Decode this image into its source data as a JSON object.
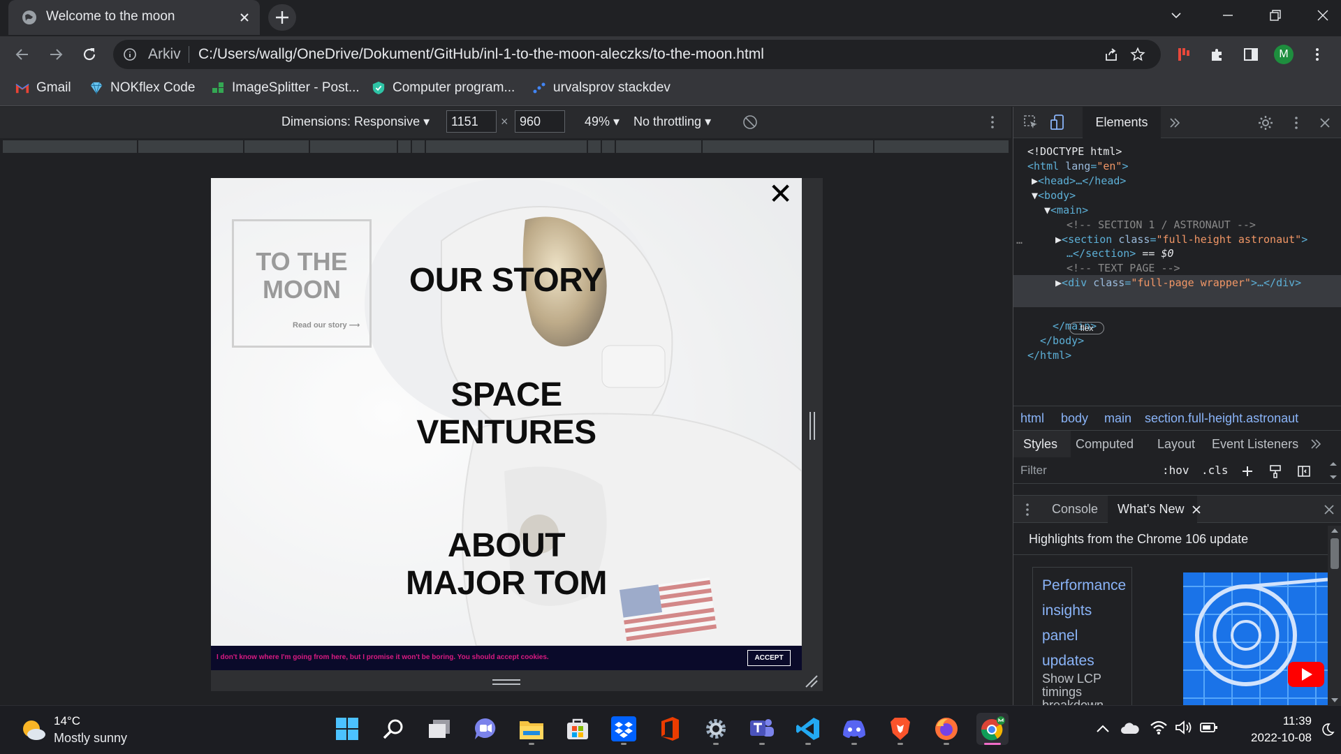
{
  "browser": {
    "tab_title": "Welcome to the moon",
    "omnibox_site_label": "Arkiv",
    "url": "C:/Users/wallg/OneDrive/Dokument/GitHub/inl-1-to-the-moon-aleczks/to-the-moon.html",
    "profile_initial": "M",
    "accent_colors": {
      "frame": "#202124",
      "toolbar": "#35363a",
      "profile": "#1e8e3e"
    }
  },
  "bookmarks": [
    {
      "label": "Gmail",
      "icon": "gmail-icon"
    },
    {
      "label": "NOKflex Code",
      "icon": "diamond-icon"
    },
    {
      "label": "ImageSplitter - Post...",
      "icon": "imagesplitter-icon"
    },
    {
      "label": "Computer program...",
      "icon": "shield-icon"
    },
    {
      "label": "urvalsprov stackdev",
      "icon": "dots-icon"
    }
  ],
  "device_toolbar": {
    "dimensions_label": "Dimensions: Responsive",
    "width": "1151",
    "height": "960",
    "separator": "×",
    "zoom": "49%",
    "throttling": "No throttling"
  },
  "site": {
    "close_glyph": "✕",
    "brand_title": "TO THE MOON",
    "brand_link": "Read our story ⟶",
    "nav": [
      "OUR STORY",
      "SPACE VENTURES",
      "ABOUT MAJOR TOM"
    ],
    "cookie_text": "I don't know where I'm going from here, but I promise it won't be boring. You should accept cookies.",
    "cookie_accept": "ACCEPT"
  },
  "devtools": {
    "active_tab": "Elements",
    "dom": {
      "doctype": "<!DOCTYPE html>",
      "html_open_tag": "html",
      "html_attr": "lang",
      "html_attr_value": "\"en\"",
      "head": "<head>…</head>",
      "body_open": "<body>",
      "main_open": "<main>",
      "comment1": "<!-- SECTION 1 / ASTRONAUT -->",
      "section_tag": "section",
      "section_attr": "class",
      "section_attr_value": "\"full-height astronaut\"",
      "section_close": "…</section>",
      "section_eq": "== $0",
      "comment2": "<!-- TEXT PAGE -->",
      "div_tag": "div",
      "div_attr": "class",
      "div_attr_value": "\"full-page wrapper\"",
      "div_rest": ">…</div>",
      "badge": "flex",
      "main_close": "</main>",
      "body_close": "</body>",
      "html_close": "</html>",
      "ellipsis": "…"
    },
    "breadcrumbs": [
      "html",
      "body",
      "main",
      "section.full-height.astronaut"
    ],
    "styles_tabs": [
      "Styles",
      "Computed",
      "Layout",
      "Event Listeners"
    ],
    "filter_placeholder": "Filter",
    "filter_hov": ":hov",
    "filter_cls": ".cls",
    "drawer_tabs": [
      "Console",
      "What's New"
    ],
    "whats_new_heading": "Highlights from the Chrome 106 update",
    "whats_new_title": "Performance insights panel updates",
    "whats_new_sub": "Show LCP timings breakdown"
  },
  "taskbar": {
    "weather_temp": "14°C",
    "weather_desc": "Mostly sunny",
    "time": "11:39",
    "date": "2022-10-08",
    "apps": [
      "start-icon",
      "search-icon",
      "task-view-icon",
      "chat-icon",
      "file-explorer-icon",
      "store-icon",
      "dropbox-icon",
      "office-icon",
      "settings-icon",
      "teams-icon",
      "vscode-icon",
      "discord-icon",
      "brave-icon",
      "firefox-icon",
      "chrome-icon"
    ]
  }
}
